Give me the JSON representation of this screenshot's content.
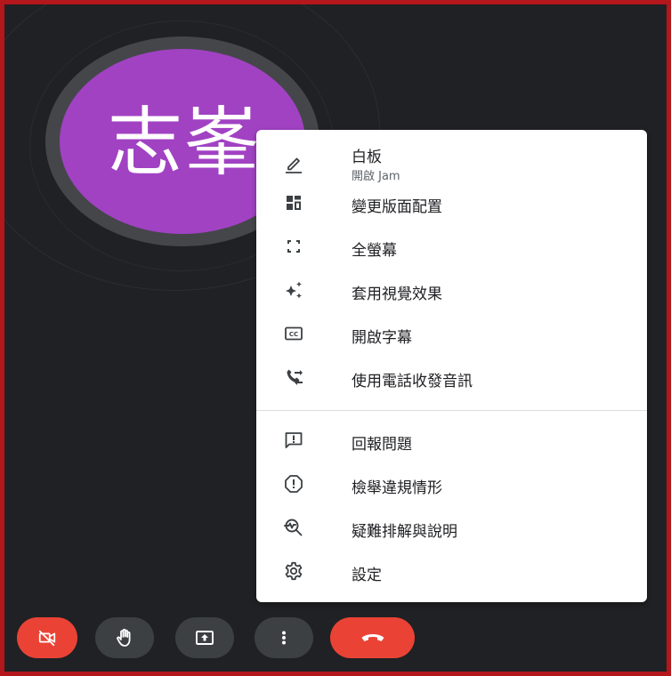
{
  "participant": {
    "avatar_initials": "志峯",
    "avatar_color": "#a142c3"
  },
  "menu": {
    "items": [
      {
        "label": "白板",
        "sublabel": "開啟 Jam",
        "icon": "pencil-icon"
      },
      {
        "label": "變更版面配置",
        "icon": "layout-icon"
      },
      {
        "label": "全螢幕",
        "icon": "fullscreen-icon"
      },
      {
        "label": "套用視覺效果",
        "icon": "sparkle-icon"
      },
      {
        "label": "開啟字幕",
        "icon": "closed-captions-icon"
      },
      {
        "label": "使用電話收發音訊",
        "icon": "phone-transfer-icon"
      },
      {
        "label": "回報問題",
        "icon": "feedback-icon"
      },
      {
        "label": "檢舉違規情形",
        "icon": "report-icon"
      },
      {
        "label": "疑難排解與說明",
        "icon": "troubleshoot-icon"
      },
      {
        "label": "設定",
        "icon": "settings-icon"
      }
    ]
  },
  "controls": [
    {
      "name": "camera-off-button",
      "icon": "video-off-icon",
      "color": "#ea4335"
    },
    {
      "name": "raise-hand-button",
      "icon": "hand-icon",
      "color": "#3c4043"
    },
    {
      "name": "present-button",
      "icon": "present-icon",
      "color": "#3c4043"
    },
    {
      "name": "more-options-button",
      "icon": "more-vert-icon",
      "color": "#3c4043"
    },
    {
      "name": "leave-call-button",
      "icon": "call-end-icon",
      "color": "#ea4335"
    }
  ],
  "colors": {
    "background": "#202124",
    "frame_border": "#b3161b",
    "menu_background": "#ffffff",
    "menu_text": "#202124",
    "icon": "#3c4043",
    "danger": "#ea4335"
  }
}
